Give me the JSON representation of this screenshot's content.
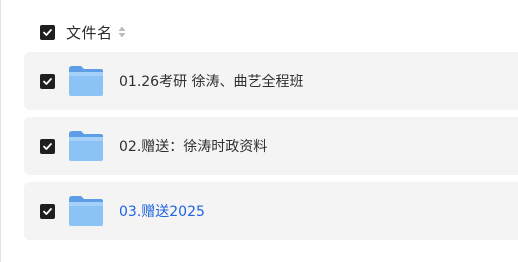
{
  "header": {
    "filename_label": "文件名"
  },
  "files": [
    {
      "name": "01.26考研 徐涛、曲艺全程班",
      "highlighted": false
    },
    {
      "name": "02.赠送：徐涛时政资料",
      "highlighted": false
    },
    {
      "name": "03.赠送2025",
      "highlighted": true
    }
  ],
  "colors": {
    "row_bg": "#f4f4f5",
    "checkbox": "#1f1f1f",
    "link": "#1f64e0",
    "folder": "#7ab7f2"
  },
  "icons": {
    "checkbox": "check-icon",
    "sort": "sort-icon",
    "folder": "folder-icon"
  }
}
